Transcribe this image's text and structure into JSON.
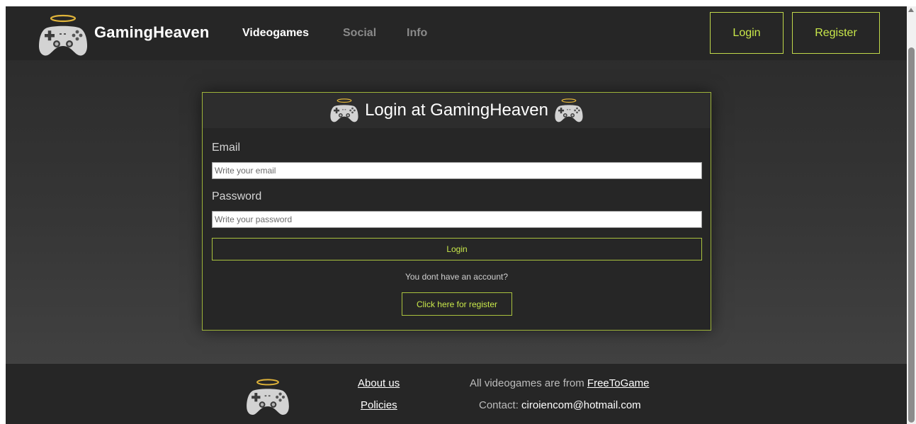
{
  "header": {
    "brand": "GamingHeaven",
    "nav": [
      {
        "label": "Videogames",
        "active": true
      },
      {
        "label": "Social",
        "active": false
      },
      {
        "label": "Info",
        "active": false
      }
    ],
    "login_label": "Login",
    "register_label": "Register",
    "logo_icon": "gamepad-with-halo-icon"
  },
  "login_card": {
    "title": "Login at GamingHeaven",
    "email_label": "Email",
    "email_placeholder": "Write your email",
    "email_value": "",
    "password_label": "Password",
    "password_placeholder": "Write your password",
    "password_value": "",
    "submit_label": "Login",
    "no_account_text": "You dont have an account?",
    "register_link_label": "Click here for register"
  },
  "footer": {
    "about_label": "About us",
    "policies_label": "Policies",
    "source_prefix": "All videogames are from",
    "source_link": "FreeToGame",
    "contact_prefix": "Contact:",
    "contact_email": "ciroiencom@hotmail.com"
  },
  "colors": {
    "accent": "#c9e84a",
    "header_bg": "#262626",
    "card_bg": "#262626",
    "page_bg": "#363636"
  }
}
